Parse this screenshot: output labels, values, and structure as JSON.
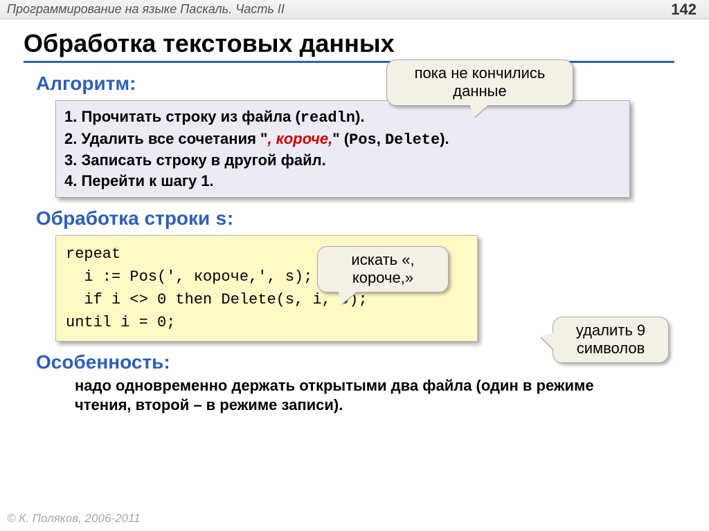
{
  "header": {
    "course": "Программирование на языке Паскаль. Часть II",
    "page": "142"
  },
  "title": "Обработка текстовых данных",
  "sections": {
    "algo_h": "Алгоритм:",
    "algo": {
      "l1a": "1. Прочитать строку из файла (",
      "l1b": "readln",
      "l1c": ").",
      "l2a": "2. Удалить все сочетания \"",
      "l2b": ", короче,",
      "l2c": "\" (",
      "l2d": "Pos",
      "l2e": ", ",
      "l2f": "Delete",
      "l2g": ").",
      "l3": "3. Записать строку в другой файл.",
      "l4": "4. Перейти к шагу 1."
    },
    "proc_h_a": "Обработка строки ",
    "proc_h_b": "s",
    "proc_h_c": ":",
    "code": {
      "l1": "repeat",
      "l2": "  i := Pos(', короче,', s);",
      "l3": "  if i <> 0 then Delete(s, i, 9);",
      "l4": "until i = 0;"
    },
    "feat_h": "Особенность:",
    "feat_text": "надо одновременно держать открытыми два файла (один в режиме чтения, второй – в режиме записи)."
  },
  "callouts": {
    "c1": "пока не кончились данные",
    "c2": "искать «, короче,»",
    "c3": "удалить 9 символов"
  },
  "copyright": "© К. Поляков, 2006-2011"
}
